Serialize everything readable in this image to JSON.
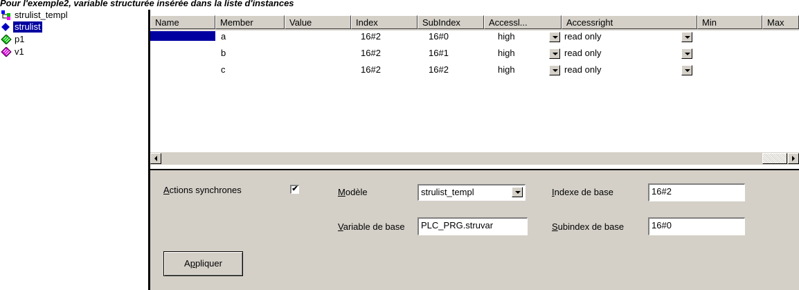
{
  "caption": "Pour l'exemple2, variable structurée insérée dans la liste d'instances",
  "tree": [
    {
      "label": "strulist_templ",
      "icon": "template-icon"
    },
    {
      "label": "strulist",
      "icon": "diamond-icon"
    },
    {
      "label": "p1",
      "icon": "green-diamond-icon"
    },
    {
      "label": "v1",
      "icon": "magenta-diamond-icon"
    }
  ],
  "grid": {
    "columns": [
      "Name",
      "Member",
      "Value",
      "Index",
      "SubIndex",
      "Accessl...",
      "Accessright",
      "Min",
      "Max"
    ],
    "rows": [
      {
        "name": "",
        "member": "a",
        "value": "",
        "index": "16#2",
        "subindex": "16#0",
        "accesslevel": "high",
        "accessright": "read only",
        "min": "",
        "max": ""
      },
      {
        "name": "",
        "member": "b",
        "value": "",
        "index": "16#2",
        "subindex": "16#1",
        "accesslevel": "high",
        "accessright": "read only",
        "min": "",
        "max": ""
      },
      {
        "name": "",
        "member": "c",
        "value": "",
        "index": "16#2",
        "subindex": "16#2",
        "accesslevel": "high",
        "accessright": "read only",
        "min": "",
        "max": ""
      }
    ]
  },
  "panel": {
    "sync_label": "Actions synchrones",
    "sync_checked": "✔",
    "model_label": "Modèle",
    "model_value": "strulist_templ",
    "base_index_label": "Indexe de base",
    "base_index_value": "16#2",
    "base_var_label": "Variable de base",
    "base_var_value": "PLC_PRG.struvar",
    "base_subindex_label": "Subindex de base",
    "base_subindex_value": "16#0",
    "apply_label": "Appliquer"
  },
  "colors": {
    "selection": "#0000a0",
    "face": "#d4d0c8"
  }
}
